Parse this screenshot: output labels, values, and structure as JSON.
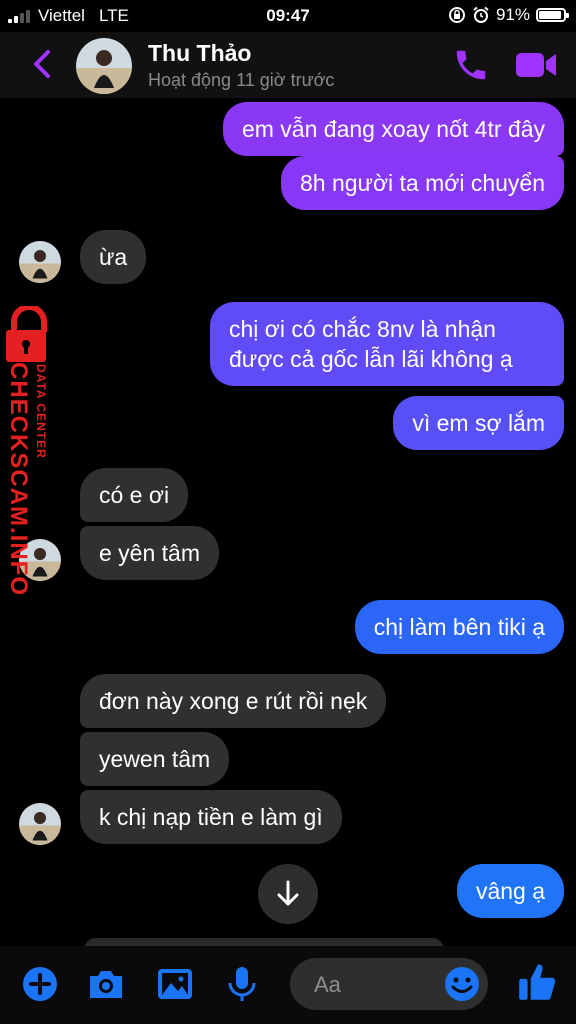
{
  "status_bar": {
    "carrier": "Viettel",
    "network": "LTE",
    "time": "09:47",
    "battery": "91%",
    "battery_level": 0.91,
    "signal_bars": 2
  },
  "header": {
    "contact_name": "Thu Thảo",
    "activity": "Hoạt động 11 giờ trước"
  },
  "messages": [
    {
      "side": "out",
      "text": "em vẫn đang xoay nốt 4tr đây"
    },
    {
      "side": "out",
      "text": "8h người ta mới chuyển"
    },
    {
      "side": "in",
      "text": "ừa"
    },
    {
      "side": "out",
      "text": "chị ơi có chắc 8nv là nhận"
    },
    {
      "side": "out",
      "text": "được cả gốc lẫn lãi không ạ"
    },
    {
      "side": "out",
      "text": "vì em sợ lắm"
    },
    {
      "side": "in",
      "text": "có e ơi"
    },
    {
      "side": "in",
      "text": "e yên tâm"
    },
    {
      "side": "out",
      "text": "chị làm bên tiki ạ"
    },
    {
      "side": "in",
      "text": "đơn này xong e rút rồi nẹk"
    },
    {
      "side": "in",
      "text": "yewen tâm"
    },
    {
      "side": "in",
      "text": "k chị nạp tiền e làm gì"
    },
    {
      "side": "out",
      "text": "vâng ạ"
    }
  ],
  "watermark": {
    "brand": "CHECKSCAM.INFO",
    "tagline": "DATA CENTER"
  },
  "composer": {
    "placeholder": "Aa",
    "icons": [
      "plus-icon",
      "camera-icon",
      "photo-icon",
      "microphone-icon",
      "emoji-icon",
      "thumbs-up-icon"
    ]
  },
  "colors": {
    "accent": "#a033ff",
    "bubble_top": "#8c35f7",
    "bubble_bottom": "#1f74f8",
    "incoming": "#303030"
  }
}
